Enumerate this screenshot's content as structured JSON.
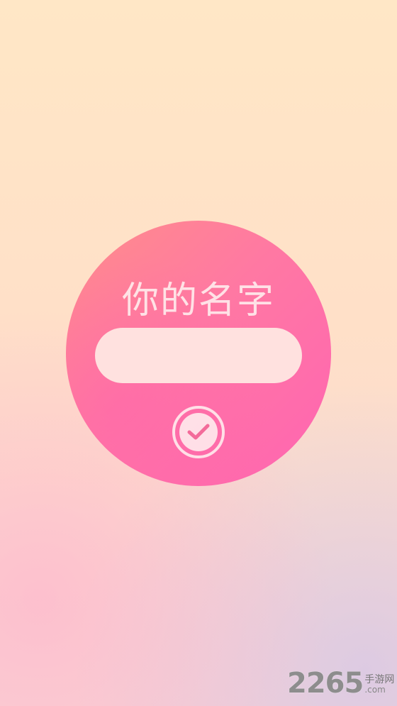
{
  "dialog": {
    "title": "你的名字",
    "input_value": "",
    "input_placeholder": "",
    "confirm_icon": "check-circle-icon"
  },
  "watermark": {
    "number": "2265",
    "site_name": "手游网",
    "domain": ".com"
  },
  "colors": {
    "background_top": "#ffe7c6",
    "background_bottom": "#f9d7d3",
    "dialog_pink": "#ff64b2",
    "dialog_orange": "#ff8d8a",
    "input_fill": "#ffe1df",
    "icon_fill": "#ffe6ea",
    "check_color": "#f36b9a"
  }
}
